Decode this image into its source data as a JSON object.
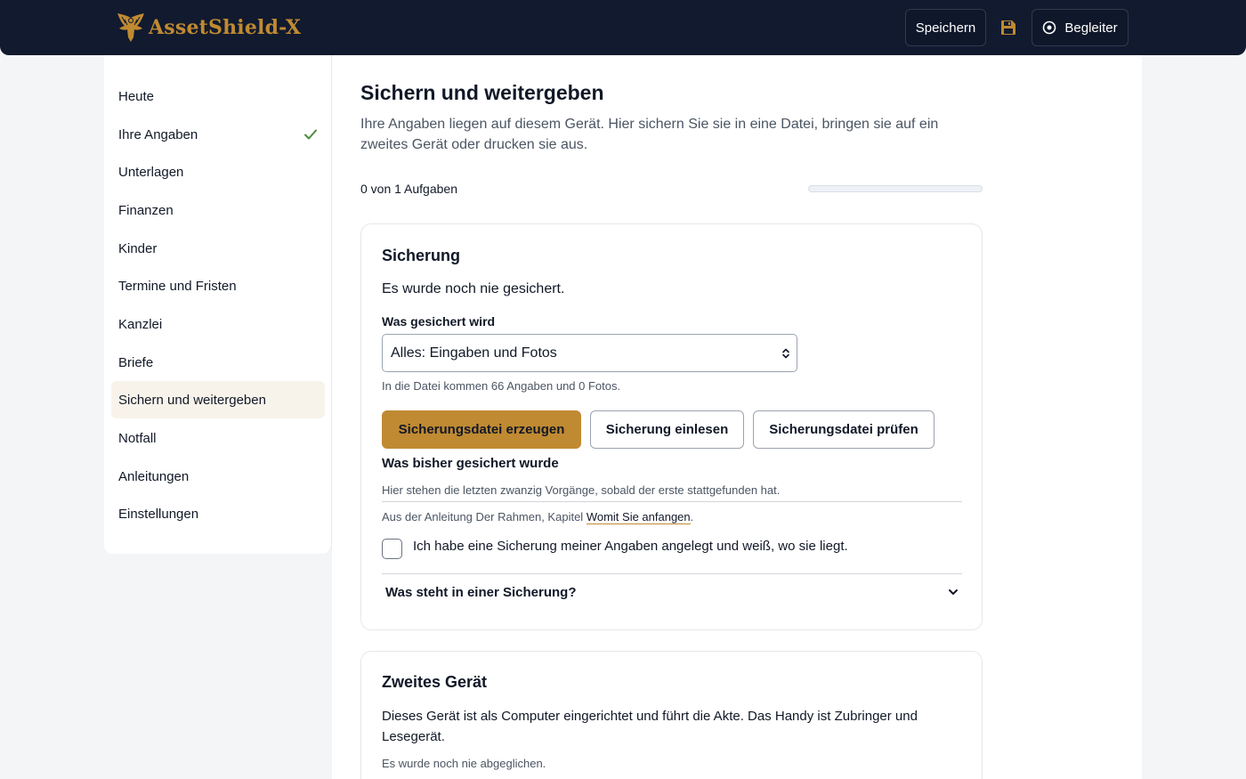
{
  "app": {
    "brand": "AssetShield-X",
    "accent": "#c08a32",
    "header_bg": "#111a2e"
  },
  "header": {
    "save_label": "Speichern",
    "companion_label": "Begleiter",
    "icons": {
      "save": "floppy-disk-icon",
      "companion": "target-circle-icon",
      "logo": "eagle-logo-icon"
    }
  },
  "sidebar": {
    "items": [
      {
        "label": "Heute"
      },
      {
        "label": "Ihre Angaben",
        "completed": true
      },
      {
        "label": "Unterlagen"
      },
      {
        "label": "Finanzen"
      },
      {
        "label": "Kinder"
      },
      {
        "label": "Termine und Fristen"
      },
      {
        "label": "Kanzlei"
      },
      {
        "label": "Briefe"
      },
      {
        "label": "Sichern und weitergeben",
        "active": true
      },
      {
        "label": "Notfall"
      },
      {
        "label": "Anleitungen"
      },
      {
        "label": "Einstellungen"
      }
    ]
  },
  "main": {
    "title": "Sichern und weitergeben",
    "description": "Ihre Angaben liegen auf diesem Gerät. Hier sichern Sie sie in eine Datei, bringen sie auf ein zweites Gerät oder drucken sie aus.",
    "progress": {
      "text": "0 von 1 Aufgaben",
      "done": 0,
      "total": 1
    }
  },
  "backup_card": {
    "title": "Sicherung",
    "status": "Es wurde noch nie gesichert.",
    "field_label": "Was gesichert wird",
    "select_value": "Alles: Eingaben und Fotos",
    "hint": "In die Datei kommen 66 Angaben und 0 Fotos.",
    "btn_create": "Sicherungsdatei erzeugen",
    "btn_import": "Sicherung einlesen",
    "btn_verify": "Sicherungsdatei prüfen",
    "history_title": "Was bisher gesichert wurde",
    "history_hint": "Hier stehen die letzten zwanzig Vorgänge, sobald der erste stattgefunden hat.",
    "source_prefix": "Aus der Anleitung Der Rahmen, Kapitel ",
    "source_link": "Womit Sie anfangen",
    "source_suffix": ".",
    "checkbox_label": "Ich habe eine Sicherung meiner Angaben angelegt und weiß, wo sie liegt.",
    "checkbox_checked": false,
    "accordion_label": "Was steht in einer Sicherung?"
  },
  "device_card": {
    "title": "Zweites Gerät",
    "description": "Dieses Gerät ist als Computer eingerichtet und führt die Akte. Das Handy ist Zubringer und Lesegerät.",
    "status": "Es wurde noch nie abgeglichen."
  }
}
